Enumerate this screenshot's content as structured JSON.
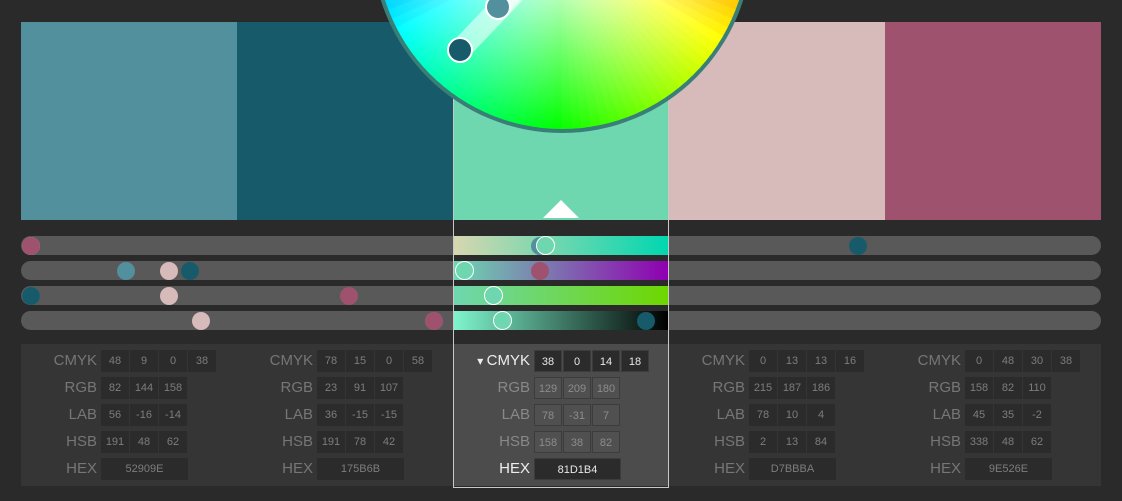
{
  "swatches": [
    {
      "color": "#52909E",
      "active": false
    },
    {
      "color": "#175B6B",
      "active": false
    },
    {
      "color": "#6ED7B0",
      "active": true
    },
    {
      "color": "#D7BBBA",
      "active": false
    },
    {
      "color": "#9E526E",
      "active": false
    }
  ],
  "active_index": 2,
  "colors": [
    {
      "cmyk": [
        "48",
        "9",
        "0",
        "38"
      ],
      "rgb": [
        "82",
        "144",
        "158"
      ],
      "lab": [
        "56",
        "-16",
        "-14"
      ],
      "hsb": [
        "191",
        "48",
        "62"
      ],
      "hex": "52909E"
    },
    {
      "cmyk": [
        "78",
        "15",
        "0",
        "58"
      ],
      "rgb": [
        "23",
        "91",
        "107"
      ],
      "lab": [
        "36",
        "-15",
        "-15"
      ],
      "hsb": [
        "191",
        "78",
        "42"
      ],
      "hex": "175B6B"
    },
    {
      "cmyk": [
        "38",
        "0",
        "14",
        "18"
      ],
      "rgb": [
        "129",
        "209",
        "180"
      ],
      "lab": [
        "78",
        "-31",
        "7"
      ],
      "hsb": [
        "158",
        "38",
        "82"
      ],
      "hex": "81D1B4"
    },
    {
      "cmyk": [
        "0",
        "13",
        "13",
        "16"
      ],
      "rgb": [
        "215",
        "187",
        "186"
      ],
      "lab": [
        "78",
        "10",
        "4"
      ],
      "hsb": [
        "2",
        "13",
        "84"
      ],
      "hex": "D7BBBA"
    },
    {
      "cmyk": [
        "0",
        "48",
        "30",
        "38"
      ],
      "rgb": [
        "158",
        "82",
        "110"
      ],
      "lab": [
        "45",
        "35",
        "-2"
      ],
      "hsb": [
        "338",
        "48",
        "62"
      ],
      "hex": "9E526E"
    }
  ],
  "labels": {
    "cmyk": "CMYK",
    "rgb": "RGB",
    "lab": "LAB",
    "hsb": "HSB",
    "hex": "HEX"
  },
  "sliders": {
    "mode": "CMYK",
    "channel_values": [
      [
        48,
        9,
        0,
        38
      ],
      [
        78,
        15,
        0,
        58
      ],
      [
        38,
        0,
        14,
        18
      ],
      [
        0,
        13,
        13,
        16
      ],
      [
        0,
        48,
        30,
        38
      ]
    ],
    "max": 100
  },
  "wheel_markers": [
    {
      "color": "#52909E",
      "name": "marker-swatch-1"
    },
    {
      "color": "#175B6B",
      "name": "marker-swatch-2"
    }
  ],
  "icons": {
    "mode_dropdown": "triangle-down-icon",
    "pointer": "triangle-up-icon"
  }
}
